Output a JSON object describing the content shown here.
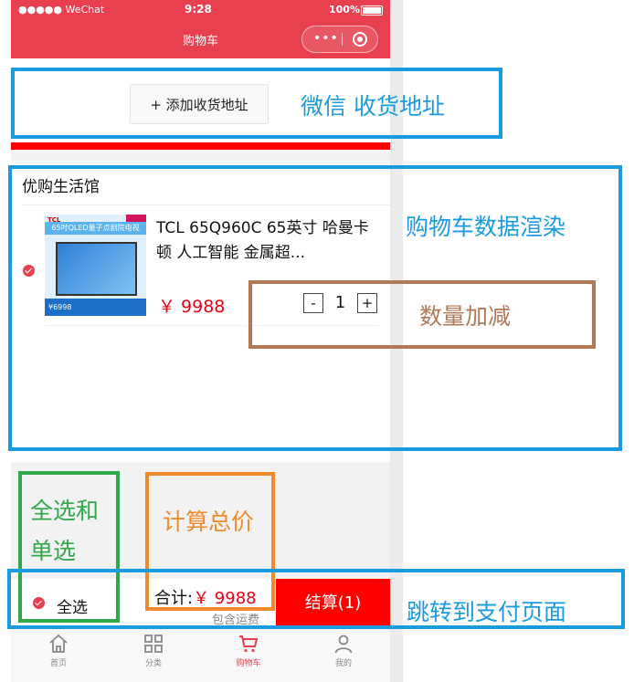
{
  "status_bar": {
    "carrier": "●●●●● WeChat",
    "time": "9:28",
    "battery": "100%"
  },
  "nav": {
    "title": "购物车",
    "more_icon": "more-dots-icon",
    "close_icon": "target-icon"
  },
  "address": {
    "button_label": "+ 添加收货地址"
  },
  "shop": {
    "name": "优购生活馆"
  },
  "item": {
    "title": "TCL 65Q960C 65英寸 哈曼卡顿 人工智能 金属超...",
    "price": "￥ 9988",
    "quantity": "1",
    "minus": "-",
    "plus": "+",
    "thumb": {
      "logo": "TCL",
      "banner": "65吋QLED量子点剧院电视",
      "footer": "¥6998"
    }
  },
  "footer": {
    "select_all": "全选",
    "total_label": "合计:",
    "total_amount": "￥ 9988",
    "freight": "包含运费",
    "checkout": "结算(1)"
  },
  "tabbar": [
    {
      "label": "首页",
      "icon": "home-icon"
    },
    {
      "label": "分类",
      "icon": "category-icon"
    },
    {
      "label": "购物车",
      "icon": "cart-icon"
    },
    {
      "label": "我的",
      "icon": "profile-icon"
    }
  ],
  "annotations": {
    "address": "微信 收货地址",
    "cart_render": "购物车数据渲染",
    "quantity": "数量加减",
    "select_line1": "全选和",
    "select_line2": "单选",
    "total": "计算总价",
    "pay": "跳转到支付页面"
  },
  "colors": {
    "theme_red": "#e8404f",
    "price_red": "#e60012",
    "checkout_red": "#ff0000",
    "annotation_blue": "#1a9be0",
    "annotation_brown": "#b07a58",
    "annotation_green": "#2ea84a",
    "annotation_orange": "#f08a2a"
  }
}
